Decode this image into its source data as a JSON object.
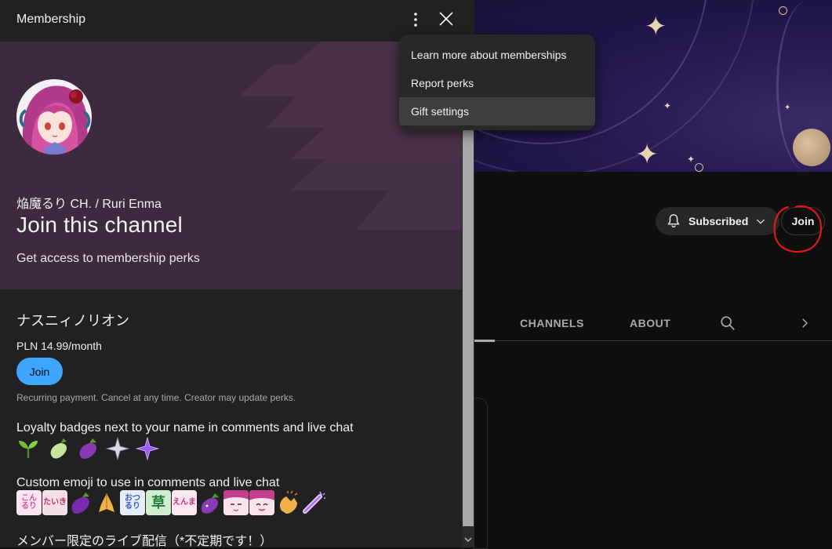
{
  "panel": {
    "title": "Membership",
    "channel_name": "焔魔るり CH. / Ruri Enma",
    "hero_title": "Join this channel",
    "hero_subtitle": "Get access to membership perks",
    "tier_name": "ナスニィノリオン",
    "price": "PLN 14.99/month",
    "join_label": "Join",
    "fine_print": "Recurring payment. Cancel at any time. Creator may update perks.",
    "perks": [
      {
        "title": "Loyalty badges next to your name in comments and live chat"
      },
      {
        "title": "Custom emoji to use in comments and live chat"
      },
      {
        "title": "メンバー限定のライブ配信（*不定期です！）"
      }
    ],
    "emoji_texts": [
      "こん るり",
      "たいき",
      "",
      "",
      "おつ るり",
      "草",
      "えんま",
      "",
      "",
      "",
      "",
      ""
    ]
  },
  "menu": {
    "items": [
      {
        "label": "Learn more about memberships"
      },
      {
        "label": "Report perks"
      },
      {
        "label": "Gift settings"
      }
    ]
  },
  "channel_page": {
    "subscribed_label": "Subscribed",
    "join_label": "Join",
    "tabs": [
      {
        "label": "CHANNELS"
      },
      {
        "label": "ABOUT"
      }
    ]
  },
  "colors": {
    "panel_bg": "#212121",
    "hero_bg": "#3e2a3f",
    "join_blue": "#3ea6ff",
    "annotation_red": "#e0161e"
  }
}
